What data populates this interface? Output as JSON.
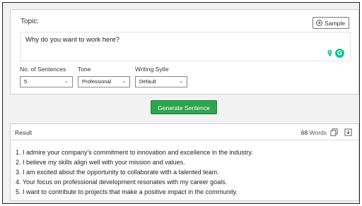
{
  "topic": {
    "label": "Topic:",
    "value": "Why do you want to work here?",
    "sample_label": "Sample"
  },
  "fields": [
    {
      "label": "No. of Sentences",
      "value": "5"
    },
    {
      "label": "Tone",
      "value": "Professional"
    },
    {
      "label": "Writing Sytle",
      "value": "Default"
    }
  ],
  "generate_label": "Generate Sentence",
  "result": {
    "label": "Result",
    "word_count": "68",
    "word_unit": "Words",
    "items": [
      "1. I admire your company's commitment to innovation and excellence in the industry.",
      "2. I believe my skills align well with your mission and values.",
      "3. I am excited about the opportunity to collaborate with a talented team.",
      "4. Your focus on professional development resonates with my career goals.",
      "5. I want to contribute to projects that make a positive impact in the community."
    ]
  },
  "colors": {
    "generate_button": "#2ea44f",
    "grammarly": "#15c39a"
  },
  "icons": [
    "plus-circle-icon",
    "bulb-icon",
    "grammarly-icon",
    "chevron-down-icon",
    "copy-icon",
    "download-icon"
  ]
}
